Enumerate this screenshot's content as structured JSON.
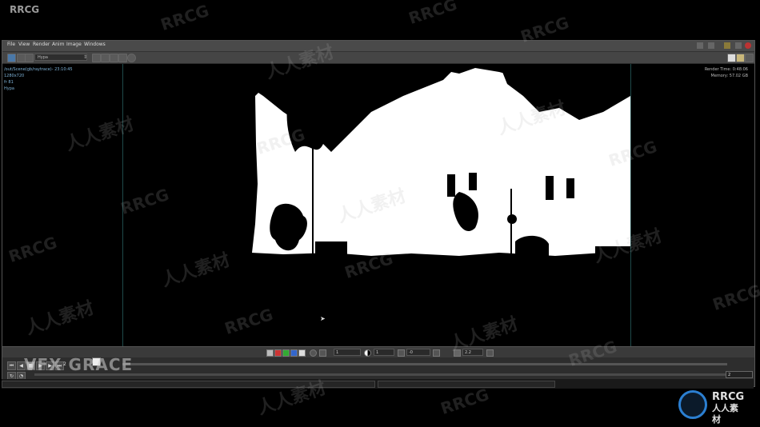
{
  "outer_title": "RRCG",
  "menu": [
    "File",
    "View",
    "Render",
    "Anim",
    "Image",
    "Windows"
  ],
  "toolbar": {
    "renderer_select": "Hypa"
  },
  "viewport": {
    "info_left": [
      "/out/Scene(gb/raytrace)- 23:10:45",
      "1280x720",
      "fr 81",
      "Hypa"
    ],
    "render_time_label": "Render Time: 0:48:06",
    "memory_label": "Memory:      57.02 GB"
  },
  "viewer_controls": {
    "channel_count": "1",
    "exposure": "1",
    "offset": "-0",
    "gamma": "2.2"
  },
  "playback": {
    "current_frame": "2",
    "frame_end": "2"
  },
  "watermark": {
    "vfx": "VFX GRACE",
    "brand": "RRCG",
    "brand_cn": "人人素材",
    "cn": "人人素材"
  },
  "colors": {
    "viewport_bg": "#000000",
    "info_text": "#7fb3d8",
    "accent": "#2b7fd1"
  }
}
